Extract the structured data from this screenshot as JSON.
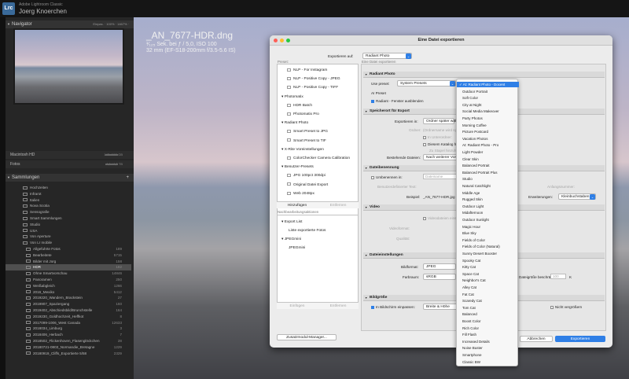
{
  "app": {
    "subtitle": "Adobe Lightroom Classic",
    "user": "Joerg Knoerchen",
    "logo": "Lrc"
  },
  "navigator": {
    "title": "Navigator",
    "zoom_options": "Einpas.  ·  100%  ·  1467% ·"
  },
  "volumes": [
    {
      "name": "Macintosh HD",
      "info": "147 / 990 GB"
    },
    {
      "name": "Fotos",
      "info": "1,1 / 1,5 TB"
    }
  ],
  "collections": {
    "title": "Sammlungen",
    "items": [
      {
        "name": "Hochzeiten",
        "count": ""
      },
      {
        "name": "Infrarot",
        "count": ""
      },
      {
        "name": "Italien",
        "count": ""
      },
      {
        "name": "Nova Scotia",
        "count": ""
      },
      {
        "name": "Sensografie",
        "count": ""
      },
      {
        "name": "Smart Sammlungen",
        "count": ""
      },
      {
        "name": "Studio",
        "count": ""
      },
      {
        "name": "USA",
        "count": ""
      },
      {
        "name": "Von Aperture",
        "count": ""
      },
      {
        "name": "Von Lr mobile",
        "count": ""
      },
      {
        "name": "Allgefuhrte Fotos",
        "count": "189"
      },
      {
        "name": "Bearbeitete",
        "count": "5715"
      },
      {
        "name": "Bilder mit Jorg",
        "count": "158"
      },
      {
        "name": "HDR",
        "count": "182"
      },
      {
        "name": "Ohne Smartvorschau",
        "count": "14846"
      },
      {
        "name": "Panoramen",
        "count": "250"
      },
      {
        "name": "Weißabgleich",
        "count": "1266"
      },
      {
        "name": "2016_Mexiko",
        "count": "5412"
      },
      {
        "name": "2019220_Wandern_Brackstein",
        "count": "27"
      },
      {
        "name": "2019907_Spaziergang",
        "count": "160"
      },
      {
        "name": "2019402_Abschiedsbild/Brunchstelle",
        "count": "164"
      },
      {
        "name": "2019230_Goldhochzeit_Heffkot",
        "count": "8"
      },
      {
        "name": "2017099-1006_West Canada",
        "count": "12633"
      },
      {
        "name": "2018034_Limburg",
        "count": "3"
      },
      {
        "name": "2018406_Herbach",
        "count": "7"
      },
      {
        "name": "2018502_Flickenhoven_Flasenglöckchen",
        "count": "28"
      },
      {
        "name": "20180721-0803_Normandie_Bretagne",
        "count": "1229"
      },
      {
        "name": "20180919_Cliffs_Exportierte 5/58",
        "count": "2329"
      }
    ]
  },
  "photo": {
    "filename": "_AN_7677-HDR.dng",
    "exposure": "¹⁄₁₂₅ Sek. bei ƒ / 5,0, ISO 100",
    "lens": "32 mm (EF-S18-200mm f/3.5-5.6 IS)"
  },
  "dialog": {
    "title": "Eine Datei exportieren",
    "export_to_label": "Exportieren auf:",
    "export_to_value": "Radiant Photo",
    "preset_label": "Preset:",
    "right_header": "Eine Datei exportieren",
    "presets": [
      {
        "label": "NLP - For Instagram",
        "type": "item"
      },
      {
        "label": "NLP - Positive Copy - JPEG",
        "type": "item"
      },
      {
        "label": "NLP - Positive Copy - TIFF",
        "type": "item"
      },
      {
        "label": "Photomatix",
        "type": "group"
      },
      {
        "label": "HDR Batch",
        "type": "item"
      },
      {
        "label": "Photomatix Pro",
        "type": "item"
      },
      {
        "label": "Radiant Photo",
        "type": "group"
      },
      {
        "label": "Smart Preset to JPG",
        "type": "item"
      },
      {
        "label": "Smart Preset to TIF",
        "type": "item"
      },
      {
        "label": "X-Rite Voreinstellungen",
        "type": "group"
      },
      {
        "label": "ColorChecker Camera Calibration",
        "type": "item"
      },
      {
        "label": "Benutzer-Presets",
        "type": "group"
      },
      {
        "label": "JPG 100pct 300dpi",
        "type": "item"
      },
      {
        "label": "Original Datei Export",
        "type": "item"
      },
      {
        "label": "Web 2048px",
        "type": "item"
      }
    ],
    "add_label": "Hinzufügen",
    "remove_label": "Entfernen",
    "postprocess_label": "Nachbearbeitungsaktionen",
    "postprocess": [
      {
        "label": "Export List",
        "type": "group"
      },
      {
        "label": "Liste exportierte Fotos",
        "type": "item"
      },
      {
        "label": "JPEGmini",
        "type": "group"
      },
      {
        "label": "JPEGmini",
        "type": "item"
      }
    ],
    "insert_label": "Einfügen",
    "sections": {
      "radiant": {
        "title": "Radiant Photo",
        "use_preset_label": "Use preset:",
        "use_preset_value": "System Presets",
        "ai_preset": "AI Preset",
        "hide_window": "Radiant - Fenster ausblenden"
      },
      "storage": {
        "title": "Speicherort für Export",
        "export_in_label": "Exportieren in:",
        "export_in_value": "Ordner später wählen",
        "folder_label": "Ordner:",
        "folder_value": "(Ordnername wird später angezeigt)",
        "choose_label": "Wählen...",
        "subfolder": "In Unterordner:",
        "subfolder_value": "Untergeordneter Ordner",
        "add_catalog": "Diesem Katalog hinzufügen",
        "stack": "Zu Stapel hinzufügen:",
        "existing_label": "Bestehende Dateien:",
        "existing_value": "Nach weiterer Vorgehensweise fragen"
      },
      "naming": {
        "title": "Dateibenennung",
        "rename_label": "Umbenennen in:",
        "rename_value": "Dateiname",
        "custom_label": "Benutzerdefinierter Text:",
        "start_label": "Anfangsnummer:",
        "example_label": "Beispiel:",
        "example_value": "_AN_7677-HDR.jpg",
        "extension_label": "Erweiterungen:",
        "extension_value": "Kleinbuchstaben"
      },
      "video": {
        "title": "Video",
        "include_video": "Videodateien einschließen",
        "format_label": "Videoformat:",
        "quality_label": "Qualität:"
      },
      "file_settings": {
        "title": "Dateieinstellungen",
        "format_label": "Bildformat:",
        "format_value": "JPEG",
        "quality_label": "Qualität:",
        "colorspace_label": "Farbraum:",
        "colorspace_value": "sRGB",
        "limit_label": "Dateigröße beschränken auf:",
        "limit_value": "100",
        "limit_unit": "K"
      },
      "size": {
        "title": "Bildgröße",
        "fit_label": "In Bildschirm einpassen:",
        "fit_value": "Breite & Höhe",
        "enlarge": "Nicht vergrößern"
      }
    },
    "plugin_manager": "Zusatzmodul-Manager...",
    "cancel": "Abbrechen",
    "export": "Exportieren"
  },
  "dropdown": {
    "items": [
      {
        "label": "At: Radiant Photo - Docent",
        "selected": true
      },
      {
        "label": "Outdoor Portrait"
      },
      {
        "label": "Soft Color"
      },
      {
        "label": "City at Night"
      },
      {
        "label": "Social Media Makeover"
      },
      {
        "label": "Party Photos"
      },
      {
        "label": "Morning Coffee"
      },
      {
        "label": "Picture Postcard"
      },
      {
        "label": "Vacation Photos"
      },
      {
        "label": "At: Radiant Photo - Pro"
      },
      {
        "label": "Light Powder"
      },
      {
        "label": "Clear Skin"
      },
      {
        "label": "Balanced Portrait"
      },
      {
        "label": "Balanced Portrait Plus"
      },
      {
        "label": "Studio"
      },
      {
        "label": "Natural Catchlight"
      },
      {
        "label": "Middle Age"
      },
      {
        "label": "Rugged Skin"
      },
      {
        "label": "Outdoor Light"
      },
      {
        "label": "Midafternoon"
      },
      {
        "label": "Outdoor Sunlight"
      },
      {
        "label": "Magic Hour"
      },
      {
        "label": "Blue Sky"
      },
      {
        "label": "Fields of Color"
      },
      {
        "label": "Fields of Color (Natural)"
      },
      {
        "label": "Sunny Desert Booster"
      },
      {
        "label": "Spooky Cat"
      },
      {
        "label": "Kitty Cat"
      },
      {
        "label": "Space Cat"
      },
      {
        "label": "Neighbor's Cat"
      },
      {
        "label": "Alley Cat"
      },
      {
        "label": "Fat Cat"
      },
      {
        "label": "Scaredy Cat"
      },
      {
        "label": "Tom Cat"
      },
      {
        "label": "Balanced"
      },
      {
        "label": "Boost Color"
      },
      {
        "label": "Rich Color"
      },
      {
        "label": "Fill Flash"
      },
      {
        "label": "Increased Details"
      },
      {
        "label": "Noise Buster"
      },
      {
        "label": "Smartphone"
      },
      {
        "label": "Classic BW"
      }
    ]
  },
  "colors": {
    "accent": "#2f7fe6",
    "panel": "#262626",
    "dialog": "#ececec"
  }
}
